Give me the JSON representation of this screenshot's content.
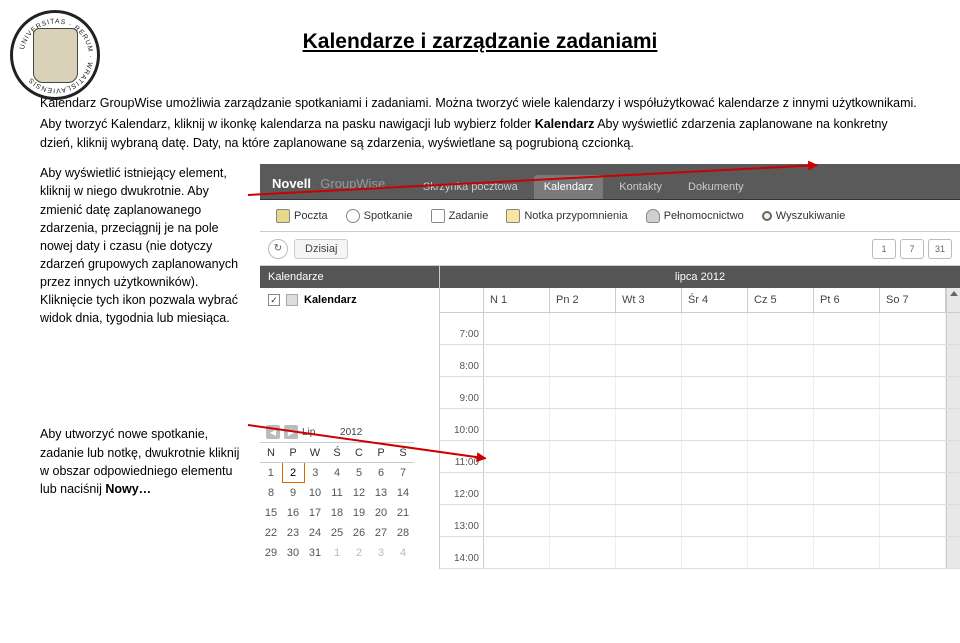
{
  "title": "Kalendarze i zarządzanie zadaniami",
  "intro": {
    "p1": "Kalendarz GroupWise umożliwia zarządzanie spotkaniami i zadaniami. Można tworzyć wiele kalendarzy i współużytkować kalendarze z innymi użytkownikami.",
    "p2a": "Aby tworzyć Kalendarz, kliknij w ikonkę kalendarza na pasku nawigacji lub wybierz folder ",
    "bold1": "Kalendarz",
    "p2b": " Aby wyświetlić zdarzenia zaplanowane na konkretny dzień, kliknij wybraną datę. Daty, na które zaplanowane są zdarzenia, wyświetlane są pogrubioną czcionką."
  },
  "side": {
    "p1": "Aby wyświetlić istniejący element, kliknij w niego dwukrotnie. Aby zmienić datę zaplanowanego zdarzenia, przeciągnij je na pole nowej daty i czasu (nie dotyczy zdarzeń grupowych zaplanowanych przez innych użytkowników). Kliknięcie tych ikon pozwala wybrać widok dnia, tygodnia lub miesiąca.",
    "p2a": "Aby utworzyć nowe spotkanie, zadanie lub notkę, dwukrotnie kliknij w obszar odpowiedniego elementu lub naciśnij ",
    "bold2": "Nowy…"
  },
  "app": {
    "brand1": "Novell",
    "brand2": "GroupWise",
    "nav": [
      "Skrzynka pocztowa",
      "Kalendarz",
      "Kontakty",
      "Dokumenty"
    ],
    "toolbar": [
      "Poczta",
      "Spotkanie",
      "Zadanie",
      "Notka przypomnienia",
      "Pełnomocnictwo",
      "Wyszukiwanie"
    ],
    "today": "Dzisiaj",
    "view_btns": [
      "1",
      "7",
      "31"
    ],
    "sidebar_head": "Kalendarze",
    "sidebar_item": "Kalendarz",
    "grid_head": "lipca 2012",
    "days": [
      "N 1",
      "Pn 2",
      "Wt 3",
      "Śr 4",
      "Cz 5",
      "Pt 6",
      "So 7"
    ],
    "times": [
      "7:00",
      "8:00",
      "9:00",
      "10:00",
      "11:00",
      "12:00",
      "13:00",
      "14:00"
    ]
  },
  "minical": {
    "month": "Lip",
    "year": "2012",
    "dow": [
      "N",
      "P",
      "W",
      "Ś",
      "C",
      "P",
      "S"
    ],
    "rows": [
      [
        "1",
        "2",
        "3",
        "4",
        "5",
        "6",
        "7"
      ],
      [
        "8",
        "9",
        "10",
        "11",
        "12",
        "13",
        "14"
      ],
      [
        "15",
        "16",
        "17",
        "18",
        "19",
        "20",
        "21"
      ],
      [
        "22",
        "23",
        "24",
        "25",
        "26",
        "27",
        "28"
      ],
      [
        "29",
        "30",
        "31",
        "1",
        "2",
        "3",
        "4"
      ]
    ],
    "today": "2"
  }
}
